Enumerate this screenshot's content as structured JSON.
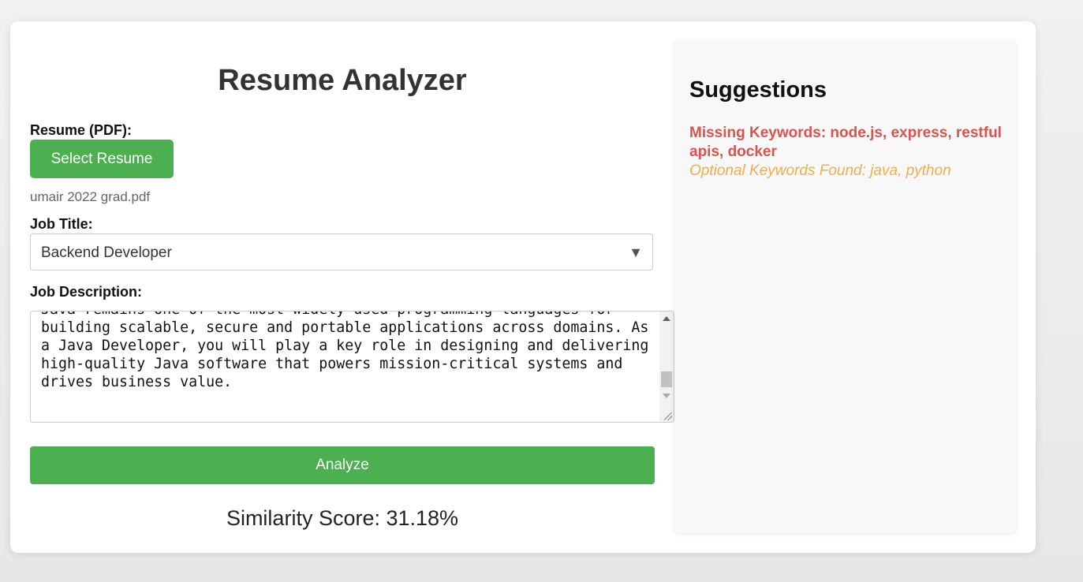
{
  "app": {
    "title": "Resume Analyzer"
  },
  "form": {
    "resume_label": "Resume (PDF):",
    "select_resume_label": "Select Resume",
    "file_name": "umair 2022 grad.pdf",
    "job_title_label": "Job Title:",
    "job_title_selected": "Backend Developer",
    "job_description_label": "Job Description:",
    "job_description_value": "Java remains one of the most widely used programming languages for\nbuilding scalable, secure and portable applications across domains. As\na Java Developer, you will play a key role in designing and delivering\nhigh-quality Java software that powers mission-critical systems and\ndrives business value.",
    "analyze_label": "Analyze",
    "similarity_score_text": "Similarity Score: 31.18%"
  },
  "suggestions": {
    "title": "Suggestions",
    "missing_keywords": "Missing Keywords: node.js, express, restful apis, docker",
    "optional_keywords": "Optional Keywords Found: java, python"
  },
  "colors": {
    "accent_green": "#4caf50",
    "missing_red": "#d9534f",
    "optional_orange": "#f0ad4e"
  },
  "icons": {
    "select_arrow": "chevron-down-icon",
    "scroll_up": "scroll-up-icon",
    "scroll_down": "scroll-down-icon",
    "resize": "resize-grip-icon"
  }
}
